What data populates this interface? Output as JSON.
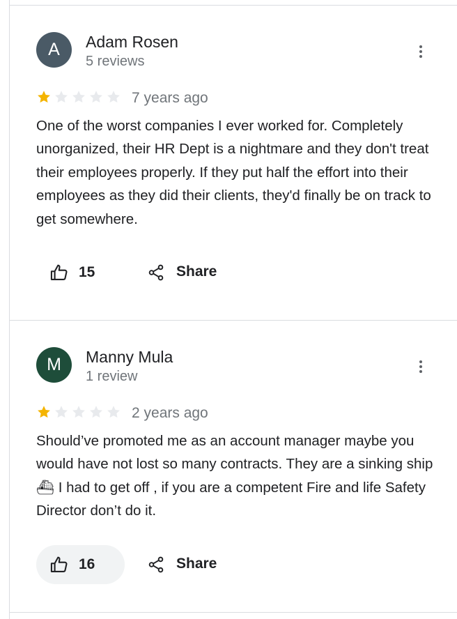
{
  "reviews": [
    {
      "avatar_letter": "A",
      "avatar_color": "#4a5a66",
      "author": "Adam Rosen",
      "review_count": "5 reviews",
      "rating": 1,
      "date": "7 years ago",
      "text": "One of the worst companies I ever worked for. Completely unorganized, their HR Dept is a nightmare and they don't treat their employees properly. If they put half the effort into their employees as they did their clients, they'd finally be on track to get somewhere.",
      "likes": "15",
      "share_label": "Share"
    },
    {
      "avatar_letter": "M",
      "avatar_color": "#1e4d3a",
      "author": "Manny Mula",
      "review_count": "1 review",
      "rating": 1,
      "date": "2 years ago",
      "text": "Should’ve promoted me as an account manager maybe you would have not lost so many contracts. They are a sinking ship ⛴ I had to get off , if you are a competent Fire and life Safety Director don’t do it.",
      "likes": "16",
      "share_label": "Share"
    }
  ],
  "colors": {
    "star_filled": "#f4b400",
    "star_empty": "#e8eaed",
    "divider": "#dadce0"
  },
  "icons": [
    "thumbs-up-icon",
    "share-icon",
    "more-vert-icon",
    "star-icon"
  ]
}
